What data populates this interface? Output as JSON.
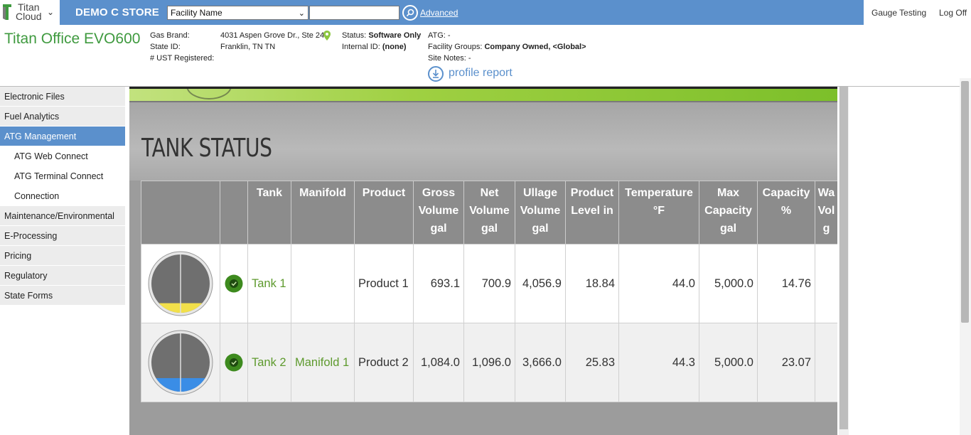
{
  "header": {
    "logo_line1": "Titan",
    "logo_line2": "Cloud",
    "store_name": "DEMO C STORE",
    "facility_select": "Facility Name",
    "search_value": "",
    "advanced_link": "Advanced",
    "user_links": [
      "Gauge Testing",
      "Log Off"
    ]
  },
  "site": {
    "name": "Titan Office EVO600",
    "gas_brand_label": "Gas Brand:",
    "state_id_label": "State ID:",
    "ust_label": "# UST Registered:",
    "address1": "4031 Aspen Grove Dr., Ste 240",
    "address2": "Franklin, TN TN",
    "status_label": "Status:",
    "status_value": "Software Only",
    "internal_label": "Internal ID:",
    "internal_value": "(none)",
    "atg_label": "ATG: -",
    "facility_groups_label": "Facility Groups:",
    "facility_groups_value": "Company Owned, <Global>",
    "site_notes_label": "Site Notes: -",
    "profile_report": "profile report"
  },
  "sidebar": {
    "items": [
      {
        "label": "Electronic Files",
        "type": "top"
      },
      {
        "label": "Fuel Analytics",
        "type": "top"
      },
      {
        "label": "ATG Management",
        "type": "active"
      },
      {
        "label": "ATG Web Connect",
        "type": "sub"
      },
      {
        "label": "ATG Terminal Connect",
        "type": "sub"
      },
      {
        "label": "Connection",
        "type": "sub"
      },
      {
        "label": "Maintenance/Environmental",
        "type": "top"
      },
      {
        "label": "E-Processing",
        "type": "top"
      },
      {
        "label": "Pricing",
        "type": "top"
      },
      {
        "label": "Regulatory",
        "type": "top"
      },
      {
        "label": "State Forms",
        "type": "top"
      }
    ]
  },
  "tank_status": {
    "title": "TANK STATUS",
    "columns": [
      "",
      "",
      "Tank",
      "Manifold",
      "Product",
      "Gross Volume gal",
      "Net Volume gal",
      "Ullage Volume gal",
      "Product Level in",
      "Temperature °F",
      "Max Capacity gal",
      "Capacity %",
      "Wa Vol g"
    ],
    "rows": [
      {
        "tank": "Tank 1",
        "manifold": "",
        "product": "Product 1",
        "gross": "693.1",
        "net": "700.9",
        "ullage": "4,056.9",
        "level": "18.84",
        "temp": "44.0",
        "max": "5,000.0",
        "capacity": "14.76",
        "fill_fraction": 0.15,
        "color": "#f2e04a"
      },
      {
        "tank": "Tank 2",
        "manifold": "Manifold 1",
        "product": "Product 2",
        "gross": "1,084.0",
        "net": "1,096.0",
        "ullage": "3,666.0",
        "level": "25.83",
        "temp": "44.3",
        "max": "5,000.0",
        "capacity": "23.07",
        "fill_fraction": 0.23,
        "color": "#3a8de6"
      }
    ]
  },
  "colors": {
    "topbar": "#5b90cc",
    "site_name": "#3f9a3f",
    "link_green": "#5e9a2e",
    "table_header": "#8c8c8c"
  }
}
